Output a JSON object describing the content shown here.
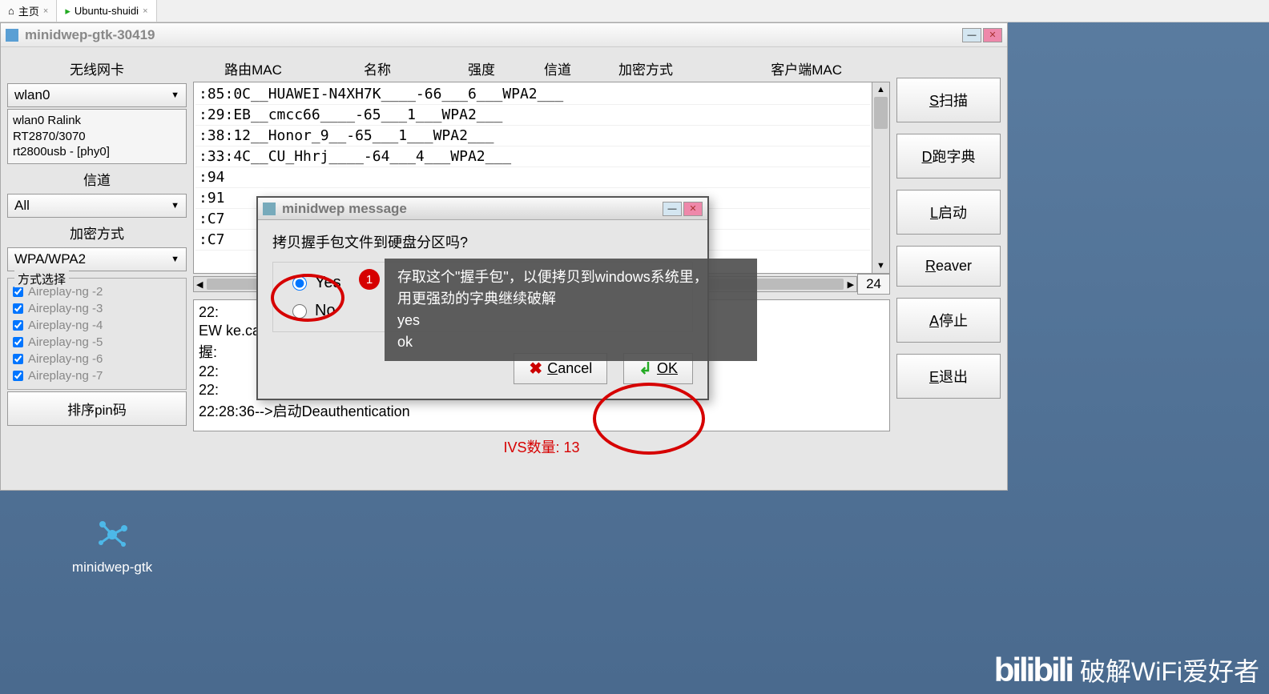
{
  "tabs": [
    {
      "label": "主页"
    },
    {
      "label": "Ubuntu-shuidi"
    }
  ],
  "window": {
    "title": "minidwep-gtk-30419"
  },
  "left": {
    "wlan_label": "无线网卡",
    "wlan_value": "wlan0",
    "wlan_info": "wlan0 Ralink\nRT2870/3070\nrt2800usb - [phy0]",
    "channel_label": "信道",
    "channel_value": "All",
    "enc_label": "加密方式",
    "enc_value": "WPA/WPA2",
    "mode_label": "方式选择",
    "checks": [
      "Aireplay-ng -2",
      "Aireplay-ng -3",
      "Aireplay-ng -4",
      "Aireplay-ng -5",
      "Aireplay-ng -6",
      "Aireplay-ng -7"
    ],
    "pin_btn": "排序pin码"
  },
  "headers": {
    "mac": "路由MAC",
    "name": "名称",
    "signal": "强度",
    "channel": "信道",
    "enc": "加密方式",
    "client": "客户端MAC"
  },
  "networks": [
    ":85:0C__HUAWEI-N4XH7K____-66___6___WPA2___",
    ":29:EB__cmcc66____-65___1___WPA2___",
    ":38:12__Honor_9__-65___1___WPA2___",
    ":33:4C__CU_Hhrj____-64___4___WPA2___",
    ":94",
    ":91",
    ":C7",
    ":C7"
  ],
  "count": "24",
  "log": [
    "22:",
    "EW                                                                                    ke.cap.wkp",
    "握:",
    "22:",
    "22:",
    "22:28:36-->启动Deauthentication"
  ],
  "ivs": "IVS数量: 13",
  "buttons": {
    "scan": {
      "u": "S",
      "t": "扫描"
    },
    "dict": {
      "u": "D",
      "t": "跑字典"
    },
    "launch": {
      "u": "L",
      "t": "启动"
    },
    "reaver": {
      "u": "R",
      "t": "eaver"
    },
    "stop": {
      "u": "A",
      "t": "停止"
    },
    "exit": {
      "u": "E",
      "t": "退出"
    }
  },
  "dialog": {
    "title": "minidwep message",
    "prompt": "拷贝握手包文件到硬盘分区吗?",
    "yes": "Yes",
    "no": "No",
    "cancel": "Cancel",
    "ok": "OK"
  },
  "annotation": {
    "num": "1",
    "tip": "存取这个\"握手包\"，以便拷贝到windows系统里，\n用更强劲的字典继续破解\nyes\nok"
  },
  "desktop": {
    "label": "minidwep-gtk"
  },
  "watermark": {
    "logo": "bilibili",
    "text": "破解WiFi爱好者"
  }
}
